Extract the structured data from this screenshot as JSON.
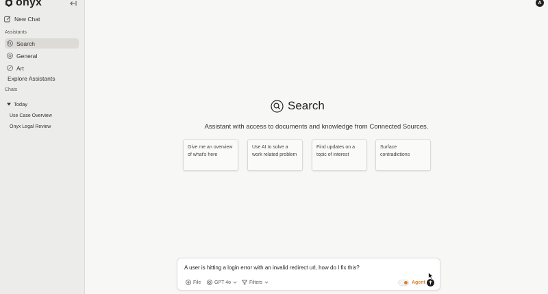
{
  "app": {
    "name": "onyx"
  },
  "sidebar": {
    "new_chat": "New Chat",
    "assistants_label": "Assistants",
    "assistants": [
      {
        "label": "Search",
        "icon": "search-circle-icon",
        "active": true
      },
      {
        "label": "General",
        "icon": "circle-icon",
        "active": false
      },
      {
        "label": "Art",
        "icon": "palette-icon",
        "active": false
      }
    ],
    "explore": "Explore Assistants",
    "chats_label": "Chats",
    "today_label": "Today",
    "chats": [
      "Use Case Overview",
      "Onyx Legal Review"
    ]
  },
  "header": {
    "avatar_initial": "A"
  },
  "main": {
    "title": "Search",
    "subtitle": "Assistant with access to documents and knowledge from Connected Sources.",
    "starters": [
      "Give me an overview of what's here",
      "Use AI to solve a work related problem",
      "Find updates on a topic of interest",
      "Surface contradictions"
    ]
  },
  "composer": {
    "message": "A user is hitting a login error with an invalid redirect url, how do I fix this?",
    "file_label": "File",
    "model_label": "GPT 4o",
    "filters_label": "Filters",
    "agent_label": "Agent",
    "agent_enabled": true,
    "colors": {
      "agent_accent": "#d9822b"
    }
  }
}
